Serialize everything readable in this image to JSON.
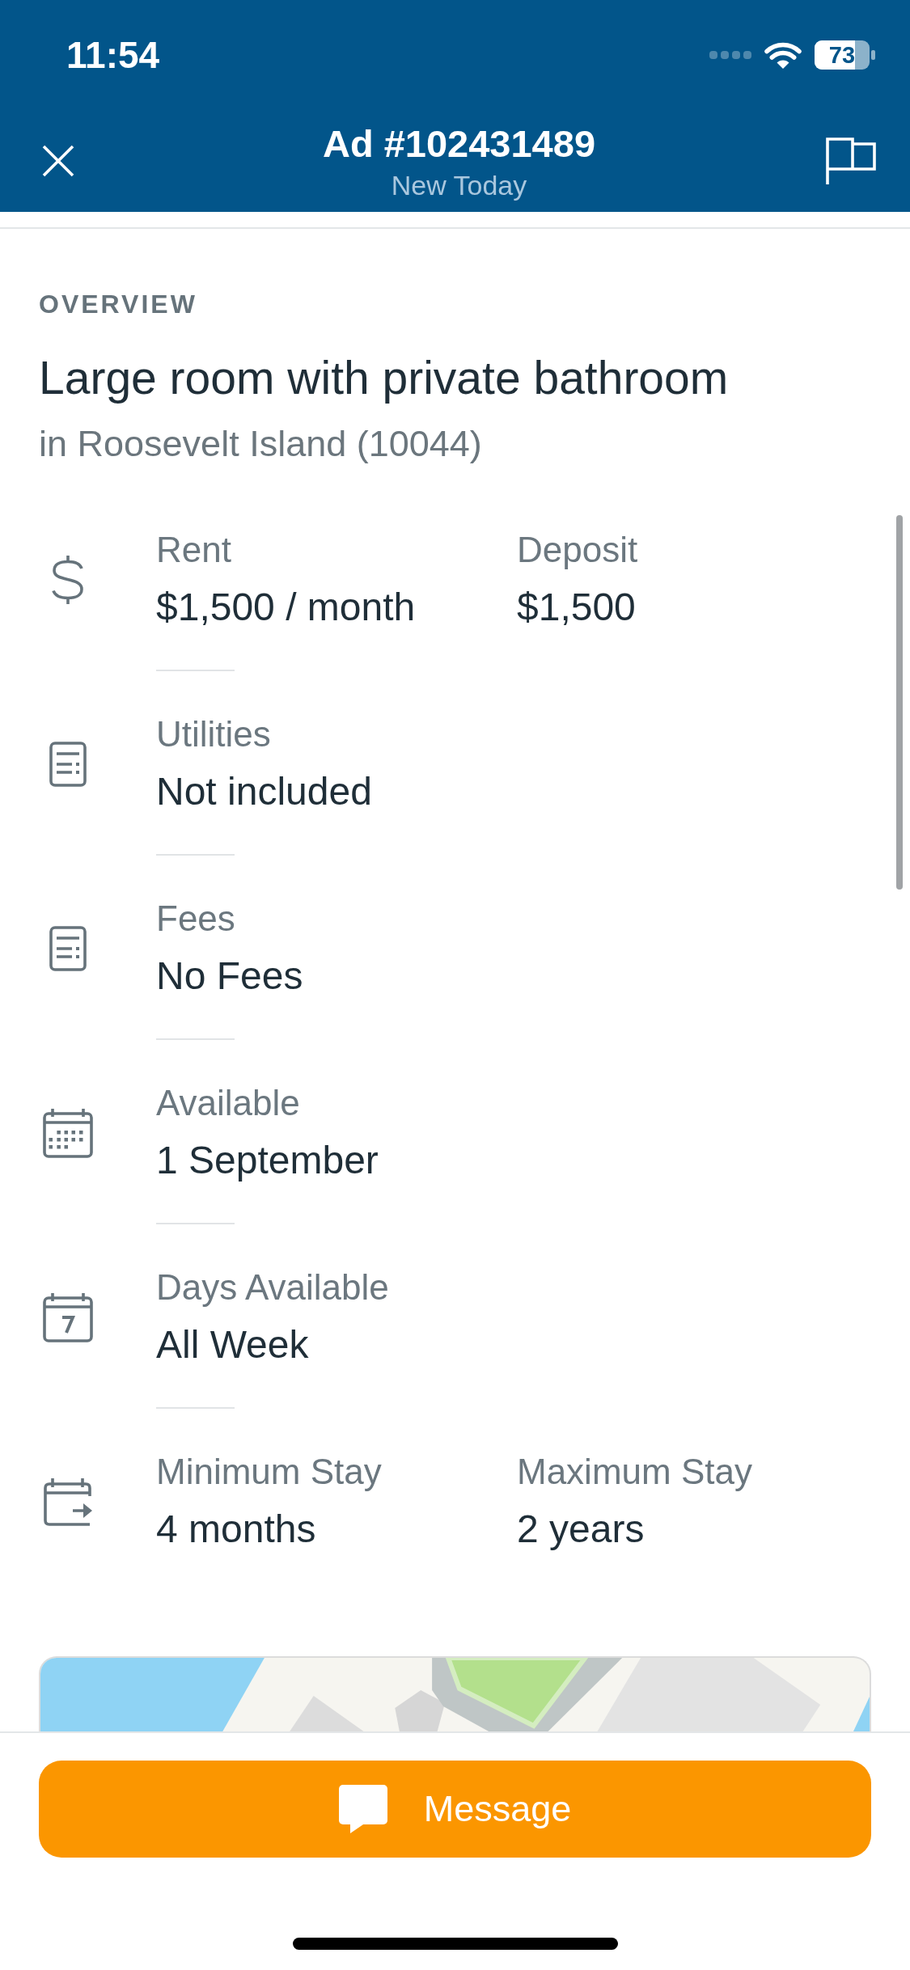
{
  "status_bar": {
    "time": "11:54",
    "battery": "73"
  },
  "header": {
    "title": "Ad #102431489",
    "subtitle": "New Today"
  },
  "overview": {
    "heading": "OVERVIEW",
    "title": "Large room with private bathroom",
    "location": "in Roosevelt Island (10044)"
  },
  "details": [
    {
      "kind": "money",
      "fields": [
        {
          "label": "Rent",
          "value": "$1,500 / month"
        },
        {
          "label": "Deposit",
          "value": "$1,500"
        }
      ]
    },
    {
      "kind": "bill",
      "fields": [
        {
          "label": "Utilities",
          "value": "Not included"
        }
      ]
    },
    {
      "kind": "bill",
      "fields": [
        {
          "label": "Fees",
          "value": "No Fees"
        }
      ]
    },
    {
      "kind": "date",
      "fields": [
        {
          "label": "Available",
          "value": "1 September"
        }
      ]
    },
    {
      "kind": "week",
      "fields": [
        {
          "label": "Days Available",
          "value": "All Week"
        }
      ]
    },
    {
      "kind": "stay",
      "fields": [
        {
          "label": "Minimum Stay",
          "value": "4 months"
        },
        {
          "label": "Maximum Stay",
          "value": "2 years"
        }
      ]
    }
  ],
  "footer": {
    "message_button": "Message"
  }
}
